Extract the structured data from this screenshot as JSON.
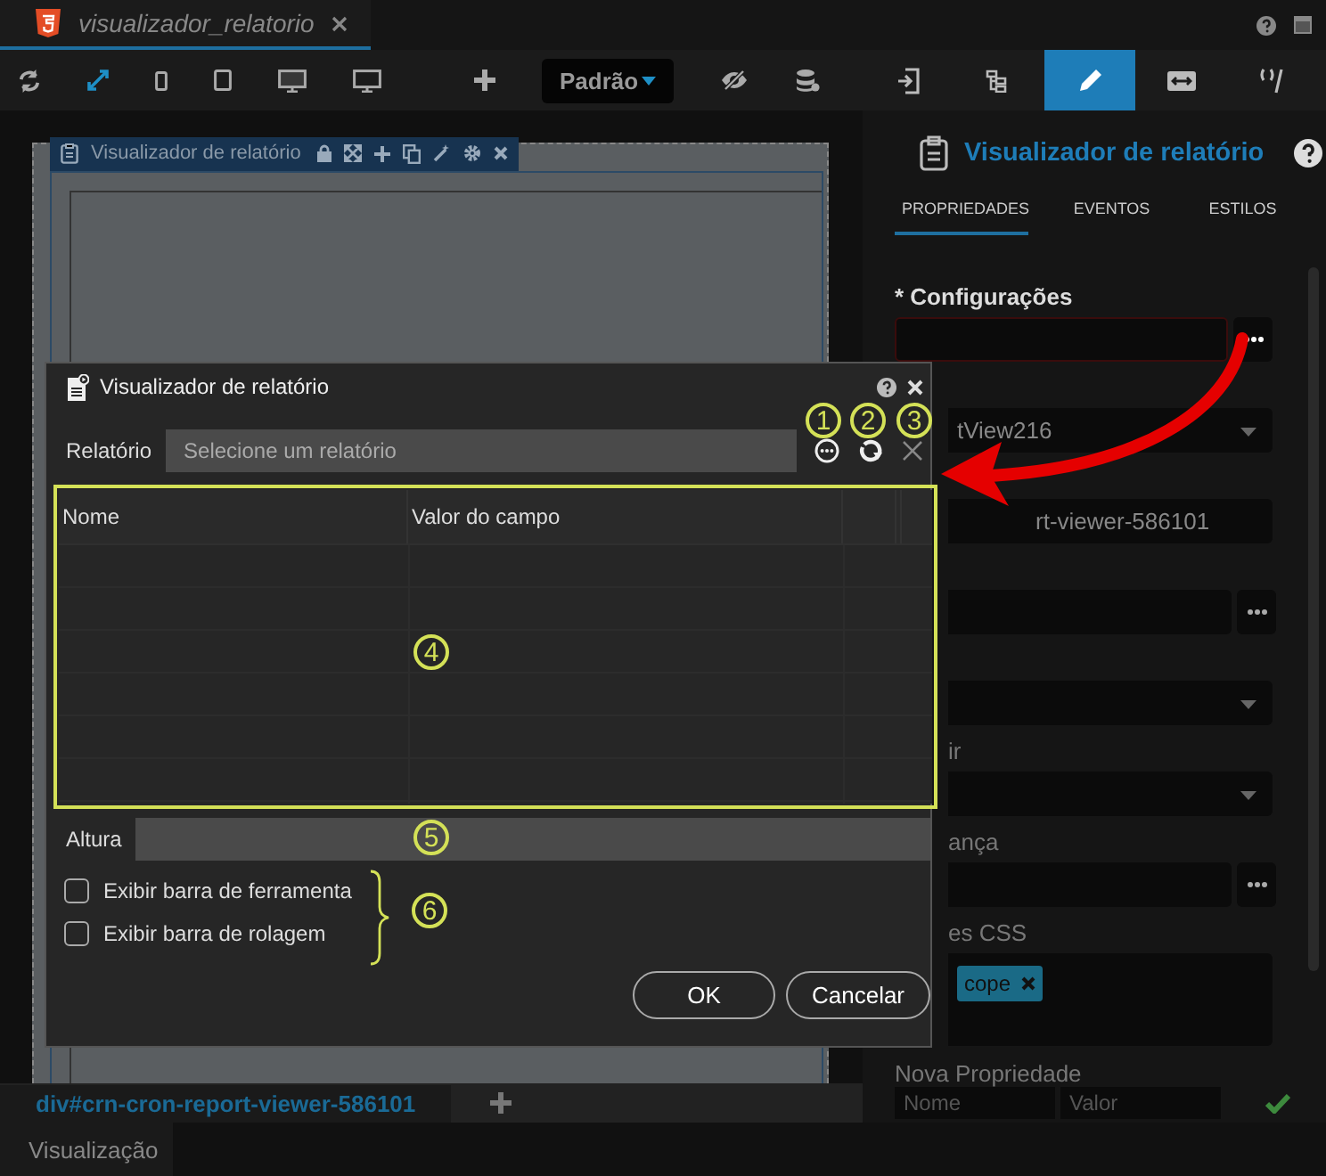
{
  "editor_tab": {
    "title": "visualizador_relatorio",
    "selected": true
  },
  "toolbar": {
    "view_mode": "Padrão"
  },
  "component_header": {
    "title": "Visualizador de relatório"
  },
  "panel": {
    "tabs": [
      {
        "selected": false
      },
      {
        "selected": false
      },
      {
        "selected": true
      },
      {
        "selected": false
      },
      {
        "selected": false
      }
    ],
    "title": "Visualizador de relatório",
    "subtabs": [
      {
        "label": "PROPRIEDADES",
        "selected": true
      },
      {
        "label": "EVENTOS",
        "selected": false
      },
      {
        "label": "ESTILOS",
        "selected": false
      }
    ],
    "fields": [
      {
        "kind": "dots",
        "label": "* Configurações",
        "invalid": true
      },
      {
        "kind": "select",
        "value": "tView216"
      },
      {
        "kind": "text",
        "value": "rt-viewer-586101"
      },
      {
        "kind": "dots"
      },
      {
        "kind": "select"
      },
      {
        "kind": "select",
        "label": "ir"
      },
      {
        "kind": "dots",
        "label": "ança"
      },
      {
        "kind": "tags",
        "label": "es CSS",
        "tags": [
          "cope"
        ]
      }
    ],
    "new_property": {
      "label": "Nova Propriedade",
      "name_placeholder": "Nome",
      "value_placeholder": "Valor"
    }
  },
  "breadcrumb": "div#crn-cron-report-viewer-586101",
  "bottom_tab": "Visualização",
  "dialog": {
    "title": "Visualizador de relatório",
    "report_label": "Relatório",
    "report_placeholder": "Selecione um relatório",
    "columns": [
      "Nome",
      "Valor do campo"
    ],
    "height_label": "Altura",
    "options": [
      {
        "label": "Exibir barra de ferramenta",
        "checked": false
      },
      {
        "label": "Exibir barra de rolagem",
        "checked": false
      }
    ],
    "buttons": [
      "OK",
      "Cancelar"
    ]
  },
  "callouts": [
    "1",
    "2",
    "3",
    "4",
    "5",
    "6"
  ]
}
